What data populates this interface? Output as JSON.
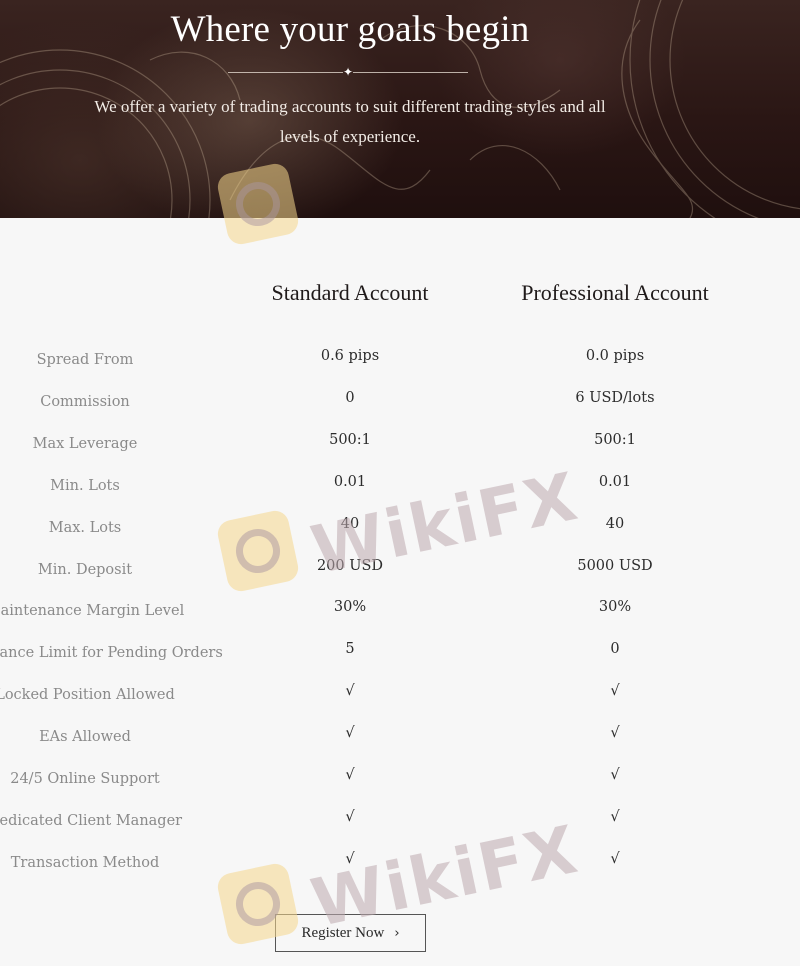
{
  "hero": {
    "title": "Where your goals begin",
    "divider_icon": "sparkle-star-icon",
    "subtitle_line1": "We offer a variety of trading accounts to suit different trading styles and all",
    "subtitle_line2": "levels of experience."
  },
  "accounts": {
    "columns": [
      "Standard Account",
      "Professional Account"
    ],
    "rows": [
      {
        "label": "Spread From",
        "standard": "0.6 pips",
        "professional": "0.0 pips"
      },
      {
        "label": "Commission",
        "standard": "0",
        "professional": "6 USD/lots"
      },
      {
        "label": "Max Leverage",
        "standard": "500:1",
        "professional": "500:1"
      },
      {
        "label": "Min. Lots",
        "standard": "0.01",
        "professional": "0.01"
      },
      {
        "label": "Max. Lots",
        "standard": "40",
        "professional": "40"
      },
      {
        "label": "Min. Deposit",
        "standard": "200 USD",
        "professional": "5000 USD"
      },
      {
        "label": "Maintenance Margin Level",
        "standard": "30%",
        "professional": "30%"
      },
      {
        "label": "Distance Limit for Pending Orders",
        "standard": "5",
        "professional": "0"
      },
      {
        "label": "Locked Position Allowed",
        "standard": "√",
        "professional": "√"
      },
      {
        "label": "EAs Allowed",
        "standard": "√",
        "professional": "√"
      },
      {
        "label": "24/5 Online Support",
        "standard": "√",
        "professional": "√"
      },
      {
        "label": "Dedicated Client Manager",
        "standard": "√",
        "professional": "√"
      },
      {
        "label": "Transaction Method",
        "standard": "√",
        "professional": "√"
      }
    ]
  },
  "cta": {
    "label": "Register Now",
    "icon": "chevron-right-icon",
    "glyph": "›"
  },
  "watermark": {
    "text": "WikiFX"
  }
}
